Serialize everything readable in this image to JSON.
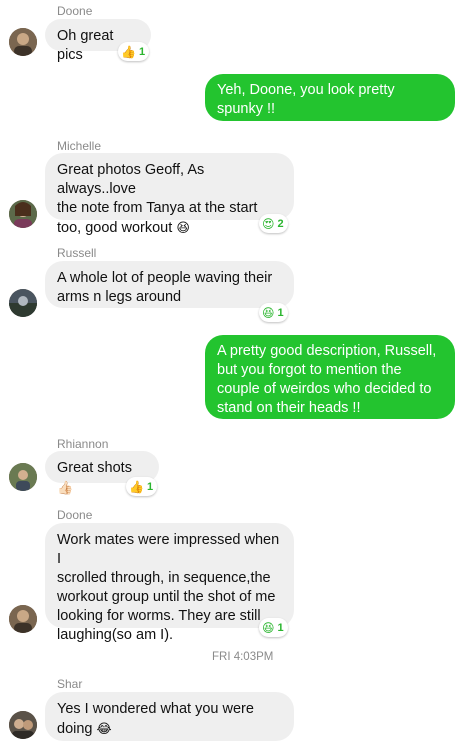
{
  "messages": [
    {
      "sender": "Doone",
      "text": "Oh great pics",
      "reaction": {
        "icon": "thumbs-up-icon",
        "emoji": "👍",
        "count": "1"
      }
    },
    {
      "sender": "me",
      "lines": [
        "Yeh, Doone, you look pretty",
        "spunky !!"
      ]
    },
    {
      "sender": "Michelle",
      "lines": [
        "Great photos Geoff, As always..love",
        "the note from Tanya at the start",
        "too, good workout"
      ],
      "inline_emoji": "😆",
      "reaction": {
        "icon": "heart-eyes-icon",
        "emoji": "😍",
        "count": "2"
      }
    },
    {
      "sender": "Russell",
      "lines": [
        "A whole lot of people waving their",
        "arms n legs around"
      ],
      "reaction": {
        "icon": "laughing-icon",
        "emoji": "😆",
        "count": "1"
      }
    },
    {
      "sender": "me",
      "lines": [
        "A pretty good description, Russell,",
        "but you forgot to mention the",
        "couple of weirdos who decided to",
        "stand on their heads !!"
      ]
    },
    {
      "sender": "Rhiannon",
      "text": "Great shots",
      "inline_emoji": "👍🏻",
      "reaction": {
        "icon": "thumbs-up-icon",
        "emoji": "👍",
        "count": "1"
      }
    },
    {
      "sender": "Doone",
      "lines": [
        "Work mates were impressed when I",
        "scrolled through, in sequence,the",
        "workout group until the shot of me",
        "looking for worms. They are still",
        "laughing(so am I)."
      ],
      "reaction": {
        "icon": "laughing-icon",
        "emoji": "😆",
        "count": "1"
      }
    },
    {
      "sender": "Shar",
      "lines": [
        "Yes I wondered what you were",
        "doing"
      ],
      "inline_emoji": "😂"
    }
  ],
  "timestamp": "FRI 4:03PM",
  "colors": {
    "outgoing": "#23c42f",
    "incoming": "#efefef",
    "reaction_count": "#2bb52f"
  }
}
